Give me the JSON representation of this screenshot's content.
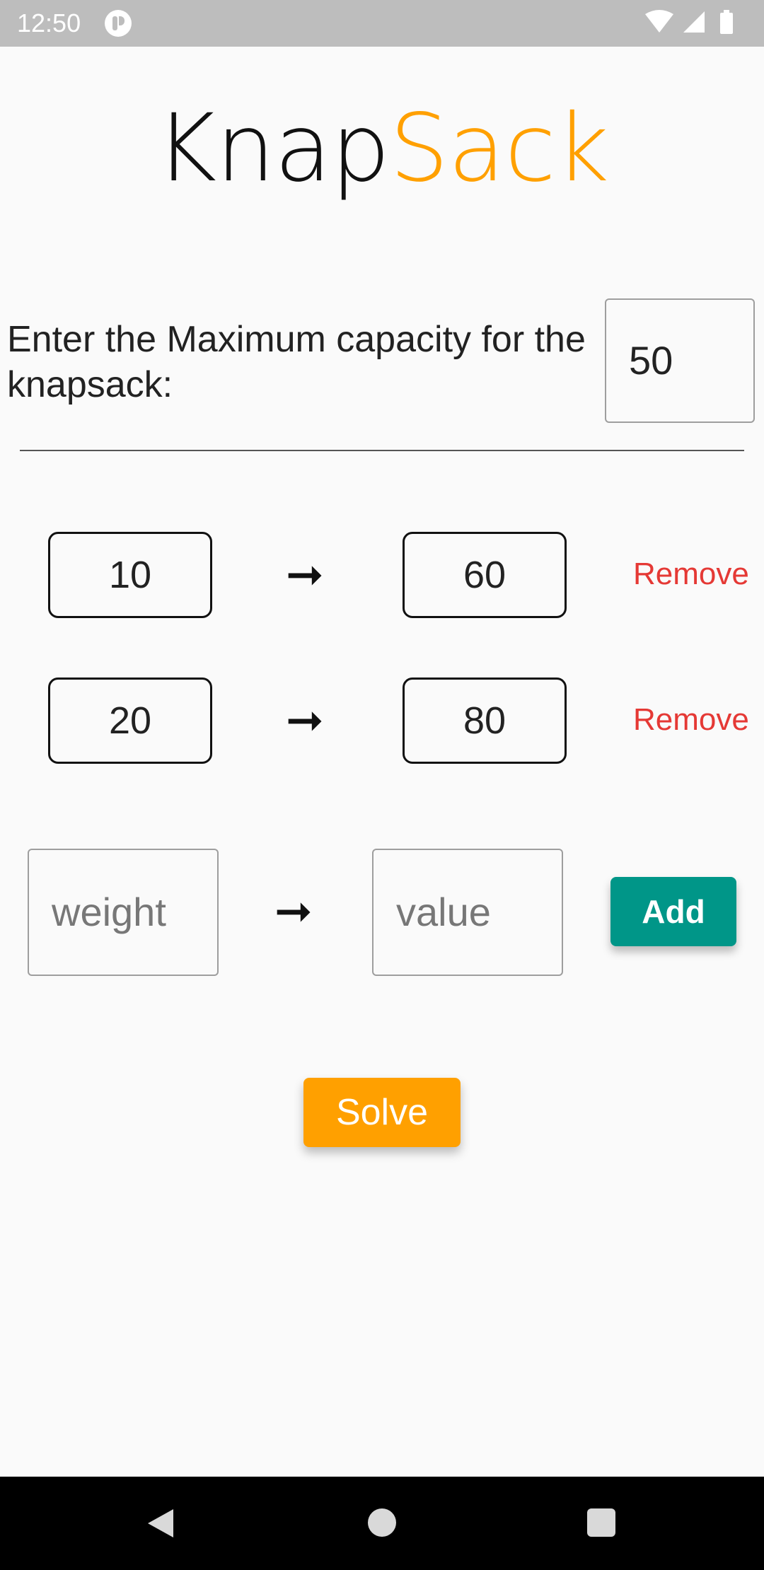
{
  "status_bar": {
    "time": "12:50",
    "icons": [
      "app-notification-icon",
      "wifi-icon",
      "signal-icon",
      "battery-icon"
    ]
  },
  "title": {
    "part1": "Knap",
    "part2": "Sack",
    "accent_color": "#ffa000"
  },
  "capacity": {
    "label": "Enter the Maximum capacity for the knapsack:",
    "value": "50"
  },
  "items": [
    {
      "weight": "10",
      "arrow": "➞",
      "value": "60",
      "remove_label": "Remove"
    },
    {
      "weight": "20",
      "arrow": "➞",
      "value": "80",
      "remove_label": "Remove"
    }
  ],
  "new_item": {
    "weight_placeholder": "weight",
    "arrow": "➞",
    "value_placeholder": "value",
    "add_label": "Add"
  },
  "solve_label": "Solve",
  "colors": {
    "add_button": "#009688",
    "solve_button": "#ffa000",
    "remove_text": "#e53935"
  },
  "nav_bar": {
    "icons": [
      "back-icon",
      "home-icon",
      "recents-icon"
    ]
  }
}
